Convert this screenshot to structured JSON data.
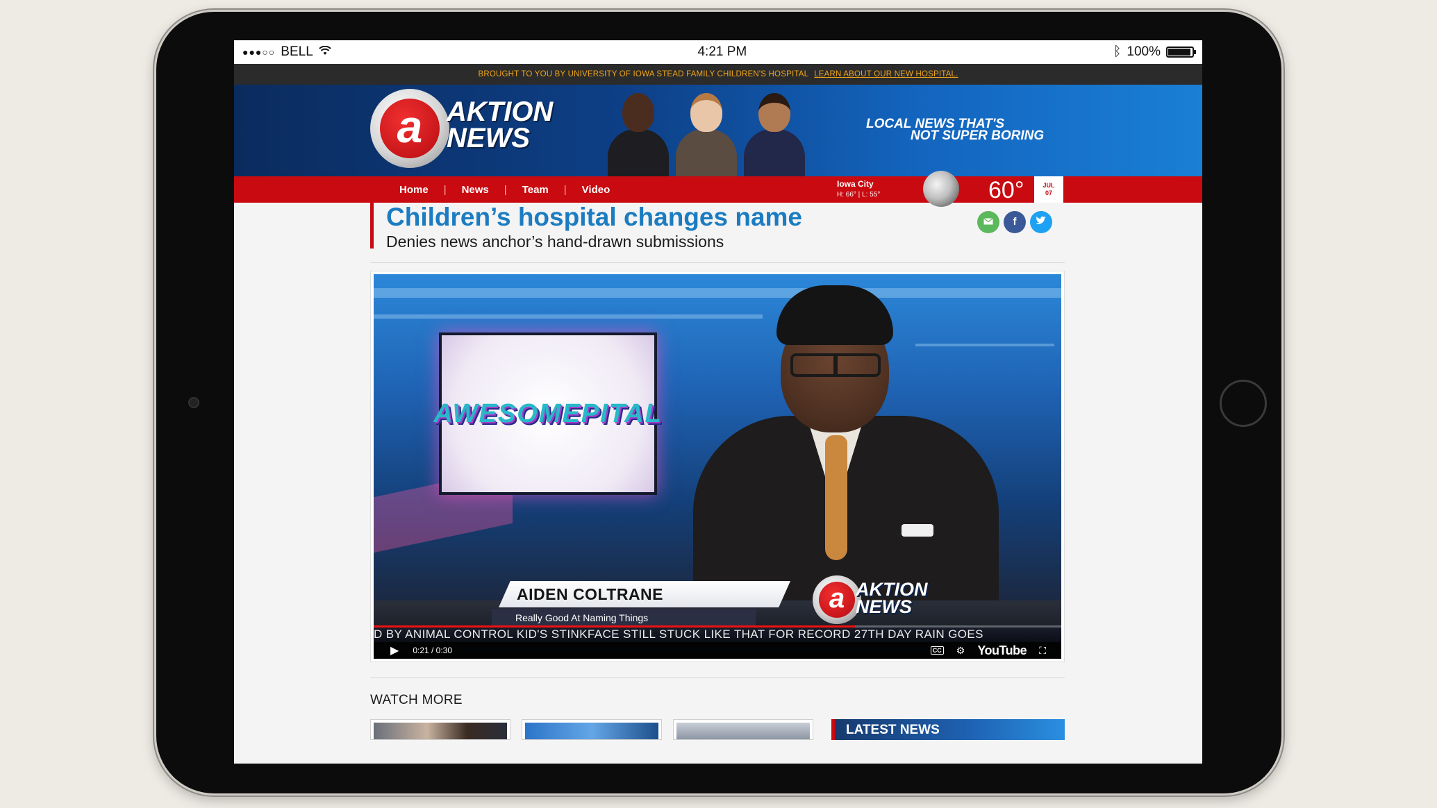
{
  "statusbar": {
    "carrier": "BELL",
    "time": "4:21 PM",
    "battery": "100%"
  },
  "promo": {
    "text": "BROUGHT TO YOU BY UNIVERSITY OF IOWA STEAD FAMILY CHILDREN'S HOSPITAL",
    "link": "LEARN ABOUT OUR NEW HOSPITAL."
  },
  "masthead": {
    "logo_glyph": "a",
    "logo_line1": "AKTION",
    "logo_line2": "NEWS",
    "tagline_line1": "LOCAL NEWS THAT'S",
    "tagline_line2": "NOT SUPER BORING"
  },
  "nav": {
    "items": [
      "Home",
      "News",
      "Team",
      "Video"
    ]
  },
  "weather": {
    "city": "Iowa City",
    "high_low": "H: 66° | L: 55°",
    "temp": "60°",
    "month": "JUL",
    "day": "07"
  },
  "article": {
    "headline": "Children’s hospital changes name",
    "subhead": "Denies news anchor’s hand-drawn submissions"
  },
  "share": {
    "email_icon": "envelope-icon",
    "facebook_icon": "f",
    "twitter_icon": "bird-icon"
  },
  "video": {
    "monitor_text": "AWESOMEPITAL",
    "name": "AIDEN COLTRANE",
    "title": "Really Good At Naming Things",
    "logo_line1": "AKTION",
    "logo_line2": "NEWS",
    "ticker": "D BY ANIMAL CONTROL    KID'S STINKFACE STILL STUCK LIKE THAT FOR RECORD 27TH DAY    RAIN GOES",
    "time": "0:21 / 0:30",
    "progress": 0.7,
    "cc": "CC",
    "brand": "YouTube"
  },
  "watch_more": {
    "label": "WATCH MORE"
  },
  "latest_news": {
    "label": "LATEST NEWS"
  },
  "colors": {
    "accent_red": "#c90a10",
    "headline_blue": "#1b7cc1",
    "promo_orange": "#f0a51c"
  }
}
